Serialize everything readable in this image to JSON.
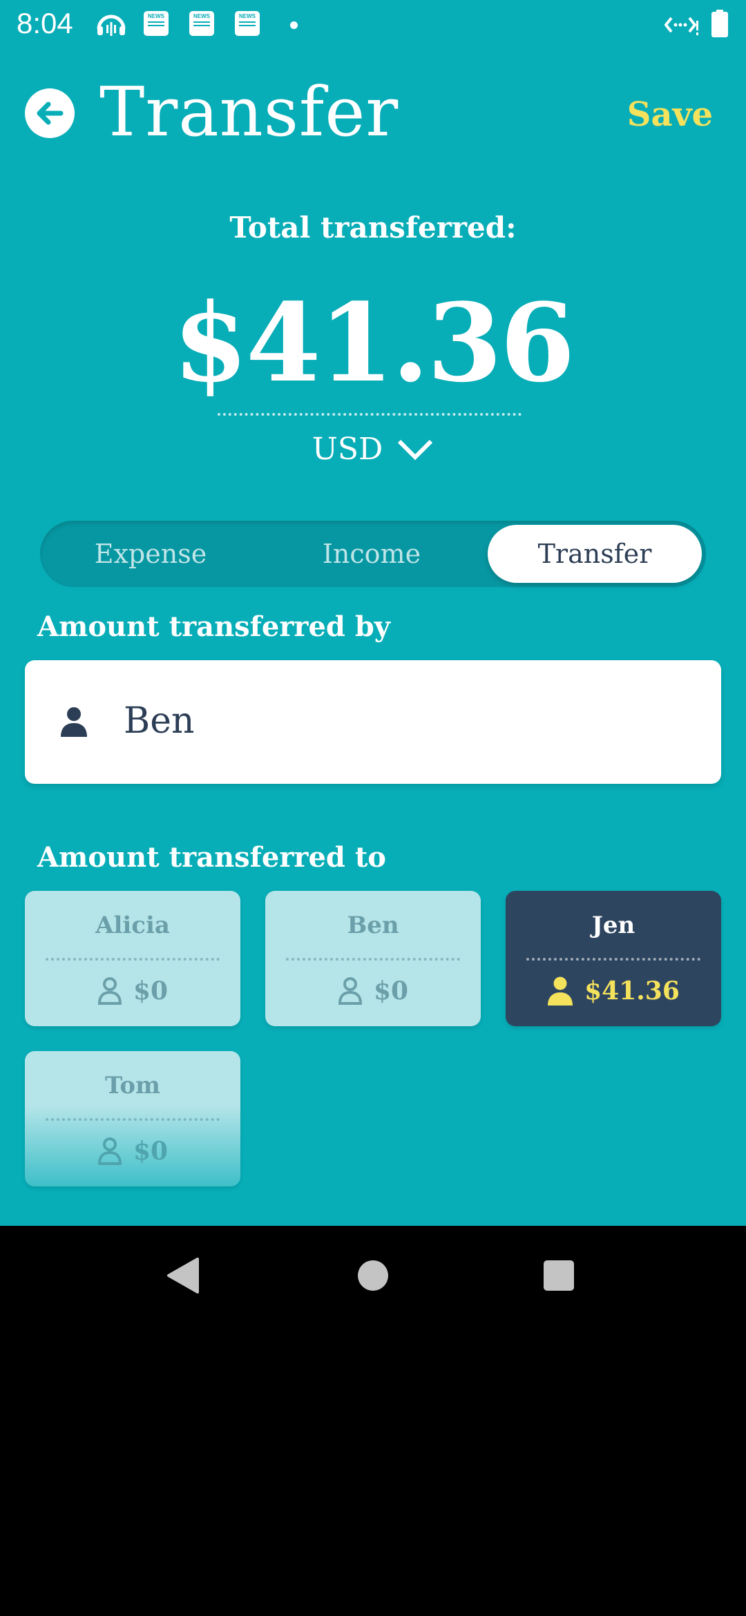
{
  "status_bar": {
    "time": "8:04",
    "icons": [
      "podcast-icon",
      "news-icon",
      "news-icon",
      "news-icon",
      "notification-dot",
      "data-signal-icon",
      "battery-icon"
    ],
    "news_icon_text": "NEWS"
  },
  "header": {
    "title": "Transfer",
    "save_label": "Save"
  },
  "total": {
    "label": "Total transferred:",
    "amount": "$41.36",
    "currency": "USD"
  },
  "tabs": [
    {
      "label": "Expense",
      "active": false
    },
    {
      "label": "Income",
      "active": false
    },
    {
      "label": "Transfer",
      "active": true
    }
  ],
  "transferred_by": {
    "label": "Amount transferred by",
    "name": "Ben"
  },
  "transferred_to": {
    "label": "Amount transferred to",
    "people": [
      {
        "name": "Alicia",
        "amount": "$0",
        "selected": false
      },
      {
        "name": "Ben",
        "amount": "$0",
        "selected": false
      },
      {
        "name": "Jen",
        "amount": "$41.36",
        "selected": true
      },
      {
        "name": "Tom",
        "amount": "$0",
        "selected": false
      }
    ]
  },
  "colors": {
    "background": "#07adb7",
    "accent": "#f5e25c",
    "dark": "#2e4560",
    "card_light": "#b5e5e9"
  }
}
